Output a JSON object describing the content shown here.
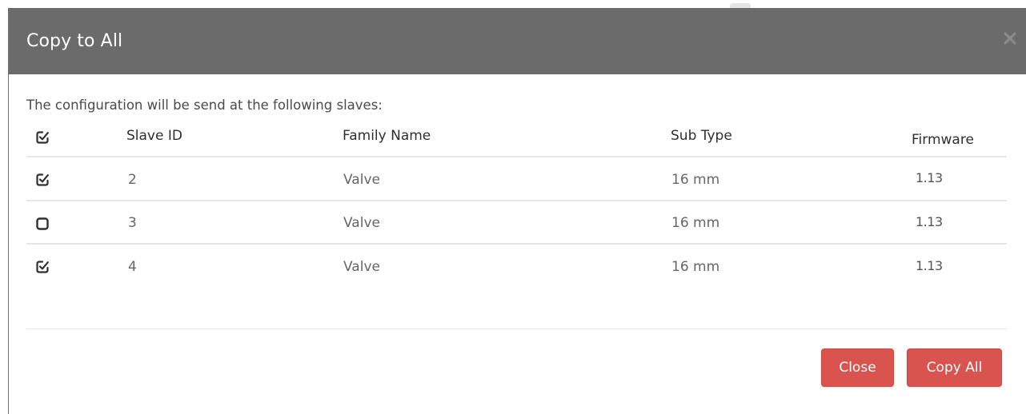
{
  "modal": {
    "title": "Copy to All",
    "intro": "The configuration will be send at the following slaves:",
    "close_icon": "close-icon"
  },
  "table": {
    "columns": {
      "select": "checkbox",
      "slave_id": "Slave ID",
      "family_name": "Family Name",
      "sub_type": "Sub Type",
      "firmware": "Firmware"
    },
    "header_checked": true,
    "rows": [
      {
        "checked": true,
        "slave_id": "2",
        "family_name": "Valve",
        "sub_type": "16 mm",
        "firmware": "1.13"
      },
      {
        "checked": false,
        "slave_id": "3",
        "family_name": "Valve",
        "sub_type": "16 mm",
        "firmware": "1.13"
      },
      {
        "checked": true,
        "slave_id": "4",
        "family_name": "Valve",
        "sub_type": "16 mm",
        "firmware": "1.13"
      }
    ]
  },
  "footer": {
    "close_label": "Close",
    "copy_all_label": "Copy All"
  },
  "colors": {
    "header_bg": "#6b6b6b",
    "button_bg": "#d9534f"
  }
}
